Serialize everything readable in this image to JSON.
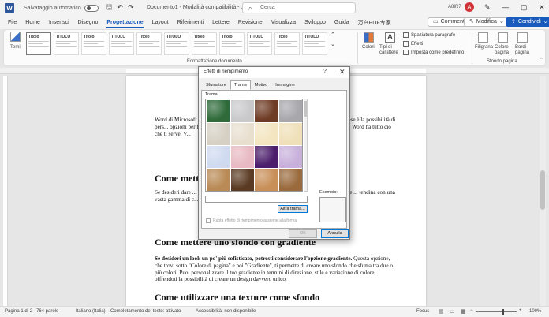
{
  "titlebar": {
    "autosave_label": "Salvataggio automatico",
    "doc_title": "Documento1 - Modalità compatibilità - ...",
    "search_placeholder": "Cerca",
    "user": "A8IR7",
    "avatar_letter": "A"
  },
  "menu": {
    "tabs": [
      "File",
      "Home",
      "Inserisci",
      "Disegno",
      "Progettazione",
      "Layout",
      "Riferimenti",
      "Lettere",
      "Revisione",
      "Visualizza",
      "Sviluppo",
      "Guida",
      "万兴PDF专家"
    ],
    "active_tab": "Progettazione",
    "comments_label": "Commenti",
    "edit_label": "Modifica",
    "share_label": "Condividi"
  },
  "ribbon": {
    "themes_label": "Temi",
    "style_tiles": [
      "Titolo",
      "TITOLO",
      "Titolo",
      "TITOLO",
      "Titolo",
      "TITOLO",
      "Titolo",
      "Titolo",
      "TITOLO",
      "Titolo",
      "TITOLO"
    ],
    "group_format": "Formattazione documento",
    "colors_label": "Colori",
    "fonts_label": "Tipi di carattere",
    "font_icon": "A",
    "paragraph_spacing": "Spaziatura paragrafo",
    "effects": "Effetti",
    "set_default": "Imposta come predefinito",
    "watermark": "Filigrana",
    "page_color": "Colore pagina",
    "page_borders": "Bordi pagina",
    "group_background": "Sfondo pagina"
  },
  "document": {
    "para1": "Word di Microsoft ... xtile che è diventato negli an... sia in ambito professionale ch... ese è la possibilità di pers... opzioni per farlo. Che tu voglia crea... re un gradiente sottile, una texture... tiva, Word ha tutto ciò che ti serve. V...",
    "heading1": "Come mett...",
    "para2": "Se desideri dare ... cesso semplice e intuitivo. Inizia s... in alto. Da lì, troverai l'opzione ... tendina con una vasta gamma di c... lo sfondo del tuo documento assum... n po' di personalità al tuo ...",
    "heading2": "Come mettere uno sfondo con gradiente",
    "para3_bold": "Se desideri un look un po' più sofisticato, potresti considerare l'opzione gradiente.",
    "para3_rest": " Questa opzione, che trovi sotto \"Colore di pagina\" e poi \"Gradiente\", ti permette di creare uno sfondo che sfuma tra due o più colori. Puoi personalizzare il tuo gradiente in termini di direzione, stile e variazione di colore, offrendoti la possibilità di creare un design davvero unico.",
    "heading3": "Come utilizzare una texture come sfondo"
  },
  "dialog": {
    "title": "Effetti di riempimento",
    "help": "?",
    "close": "✕",
    "tabs": [
      "Sfumature",
      "Trama",
      "Motivo",
      "Immagine"
    ],
    "active_tab": "Trama",
    "texture_label": "Trama:",
    "other_texture": "Altra trama...",
    "example_label": "Esempio:",
    "rotate_label": "Ruota effetto di riempimento assieme alla forma",
    "ok": "OK",
    "cancel": "Annulla",
    "texture_colors": [
      "#2f6b3a",
      "#c9c9cc",
      "#6e3b24",
      "#a8a8ac",
      "#d6d0c4",
      "#e8dfcf",
      "#f3e5c0",
      "#efe0b8",
      "#cfdaf0",
      "#e8b9c2",
      "#4b1d6b",
      "#c8b0db",
      "#b98a55",
      "#5a3a22",
      "#c88f58",
      "#9a6a3c"
    ]
  },
  "statusbar": {
    "page": "Pagina 1 di 2",
    "words": "764 parole",
    "language": "Italiano (Italia)",
    "predict": "Completamento del testo: attivato",
    "accessibility": "Accessibilità: non disponibile",
    "focus": "Focus",
    "zoom": "100%"
  }
}
